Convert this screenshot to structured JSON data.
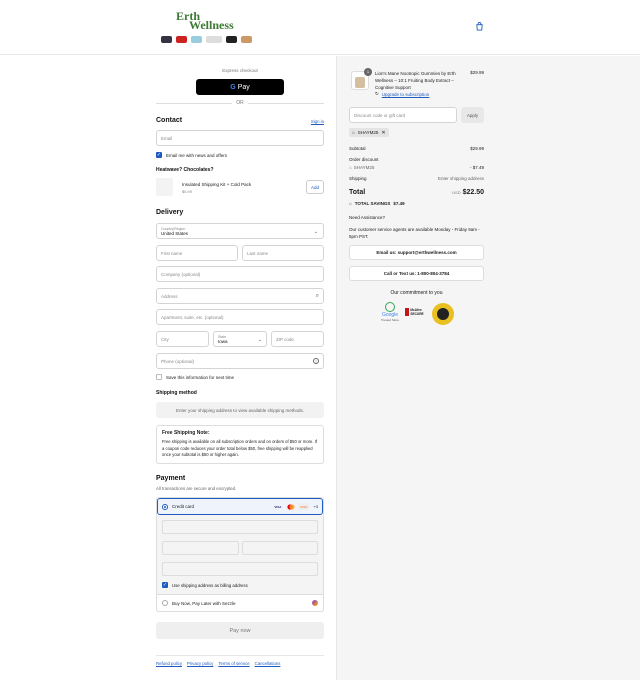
{
  "brand": {
    "logo_line1": "Erth",
    "logo_line2": "Wellness"
  },
  "checkout": {
    "express_label": "Express checkout",
    "gpay_label": "Pay",
    "or_label": "OR",
    "contact_heading": "Contact",
    "sign_in": "Sign in",
    "email_placeholder": "Email",
    "email_news_label": "Email me with news and offers",
    "upsell_heading": "Heatwave? Chocolates?",
    "upsell_item": "Insulated Shipping Kit + Cold Pack",
    "upsell_price": "$5.99",
    "upsell_add": "Add",
    "delivery_heading": "Delivery",
    "country_label": "Country/Region",
    "country_value": "United States",
    "first_name": "First name",
    "last_name": "Last name",
    "company": "Company (optional)",
    "address": "Address",
    "apartment": "Apartment, suite, etc. (optional)",
    "city": "City",
    "state_label": "State",
    "state_value": "Iowa",
    "zip": "ZIP code",
    "phone": "Phone (optional)",
    "save_info": "Save this information for next time",
    "shipping_method_heading": "Shipping method",
    "shipping_method_msg": "Enter your shipping address to view available shipping methods.",
    "free_ship_title": "Free Shipping Note:",
    "free_ship_body": "Free shipping is available on all subscription orders and on orders of $50 or more. If a coupon code reduces your order total below $50, free shipping will be reapplied once your subtotal is $50 or higher again.",
    "payment_heading": "Payment",
    "payment_sub": "All transactions are secure and encrypted.",
    "credit_card": "Credit card",
    "cards": [
      "VISA",
      "MC",
      "DISC"
    ],
    "more_cards": "+3",
    "billing_same": "Use shipping address as billing address",
    "sezzle": "Buy Now, Pay Later with Sezzle",
    "pay_now": "Pay now",
    "footer_links": [
      "Refund policy",
      "Privacy policy",
      "Terms of service",
      "Cancellations"
    ]
  },
  "summary": {
    "qty": "1",
    "product_name": "Lion's Mane Nootropic Gummies by Erth Wellness – 10:1 Fruiting Body Extract – Cognitive Support",
    "product_price": "$29.99",
    "upgrade": "Upgrade to subscription",
    "discount_placeholder": "Discount code or gift card",
    "apply": "Apply",
    "code_chip": "SHAYM25",
    "subtotal_label": "Subtotal",
    "subtotal": "$29.99",
    "order_discount_label": "Order discount",
    "discount_code": "SHAYM25",
    "discount_amount": "- $7.49",
    "shipping_label": "Shipping",
    "shipping_value": "Enter shipping address",
    "total_label": "Total",
    "currency": "USD",
    "total": "$22.50",
    "savings_label": "TOTAL SAVINGS",
    "savings": "$7.49",
    "assist_heading": "Need Assistance?",
    "assist_body": "Our customer service agents are available Monday - Friday 9am - 5pm PST.",
    "email_btn": "Email us: support@erthwellness.com",
    "call_btn": "Call or Text us: 1-800-804-3784",
    "commitment": "Our commitment to you",
    "google_badge": "Google",
    "google_sub": "Trusted Store",
    "mcafee_badge": "McAfee SECURE"
  }
}
